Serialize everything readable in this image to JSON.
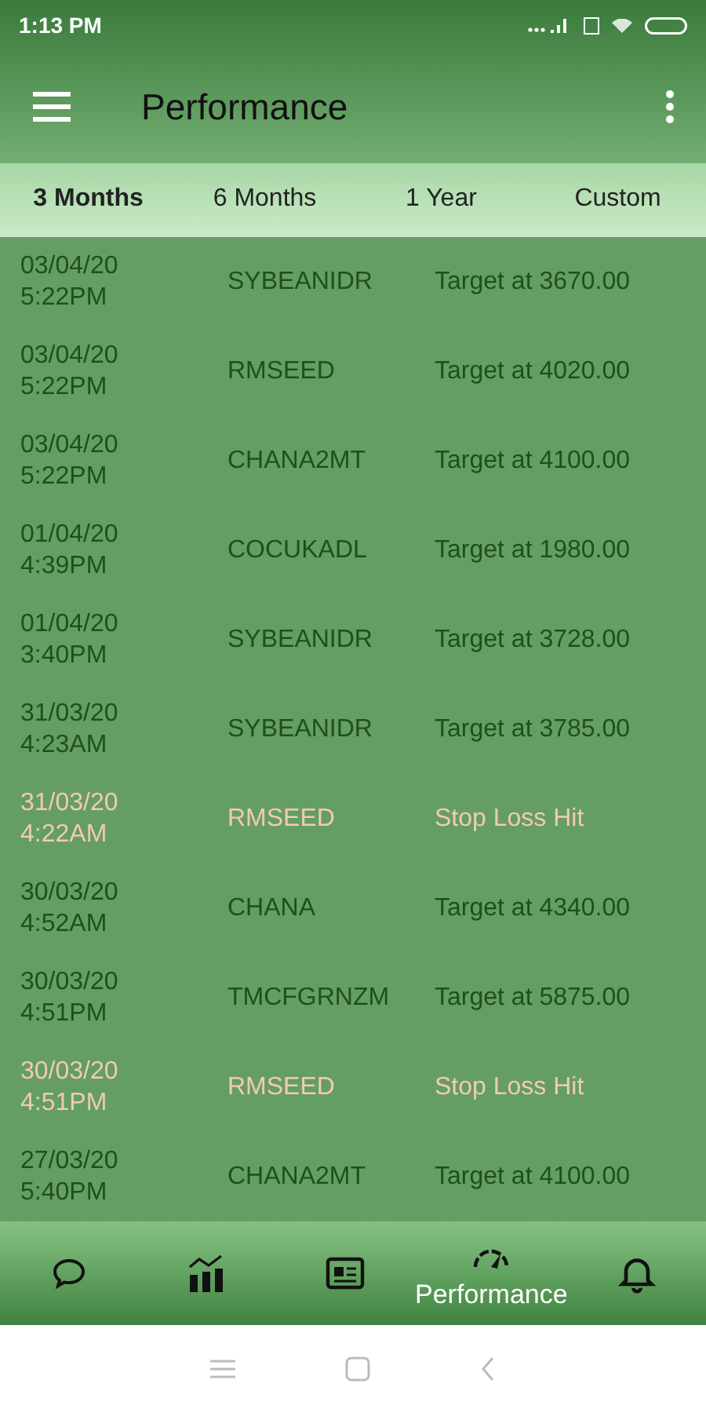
{
  "status_bar": {
    "time": "1:13 PM"
  },
  "app_bar": {
    "title": "Performance"
  },
  "tabs": [
    {
      "label": "3 Months",
      "selected": true
    },
    {
      "label": "6 Months",
      "selected": false
    },
    {
      "label": "1 Year",
      "selected": false
    },
    {
      "label": "Custom",
      "selected": false
    }
  ],
  "rows": [
    {
      "date": "03/04/20",
      "time": "5:22PM",
      "symbol": "SYBEANIDR",
      "result": "Target at 3670.00",
      "kind": "target"
    },
    {
      "date": "03/04/20",
      "time": "5:22PM",
      "symbol": "RMSEED",
      "result": "Target at 4020.00",
      "kind": "target"
    },
    {
      "date": "03/04/20",
      "time": "5:22PM",
      "symbol": "CHANA2MT",
      "result": "Target at 4100.00",
      "kind": "target"
    },
    {
      "date": "01/04/20",
      "time": "4:39PM",
      "symbol": "COCUKADL",
      "result": "Target at 1980.00",
      "kind": "target"
    },
    {
      "date": "01/04/20",
      "time": "3:40PM",
      "symbol": "SYBEANIDR",
      "result": "Target at 3728.00",
      "kind": "target"
    },
    {
      "date": "31/03/20",
      "time": "4:23AM",
      "symbol": "SYBEANIDR",
      "result": "Target at 3785.00",
      "kind": "target"
    },
    {
      "date": "31/03/20",
      "time": "4:22AM",
      "symbol": "RMSEED",
      "result": "Stop Loss Hit",
      "kind": "stoploss"
    },
    {
      "date": "30/03/20",
      "time": "4:52AM",
      "symbol": "CHANA",
      "result": "Target at 4340.00",
      "kind": "target"
    },
    {
      "date": "30/03/20",
      "time": "4:51PM",
      "symbol": "TMCFGRNZM",
      "result": "Target at 5875.00",
      "kind": "target"
    },
    {
      "date": "30/03/20",
      "time": "4:51PM",
      "symbol": "RMSEED",
      "result": "Stop Loss Hit",
      "kind": "stoploss"
    },
    {
      "date": "27/03/20",
      "time": "5:40PM",
      "symbol": "CHANA2MT",
      "result": "Target at 4100.00",
      "kind": "target"
    }
  ],
  "bottom_nav": [
    {
      "kind": "chat",
      "selected": false
    },
    {
      "kind": "chart",
      "selected": false
    },
    {
      "kind": "news",
      "selected": false
    },
    {
      "kind": "performance",
      "label": "Performance",
      "selected": true
    },
    {
      "kind": "alerts",
      "selected": false
    }
  ]
}
